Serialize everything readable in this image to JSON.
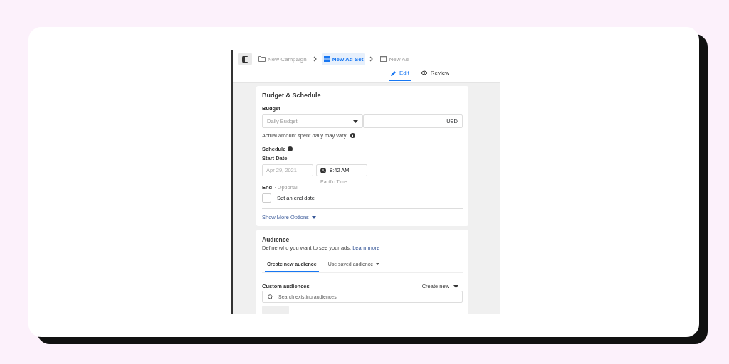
{
  "breadcrumbs": [
    {
      "label": "New Campaign",
      "kind": "folder",
      "selected": false
    },
    {
      "label": "New Ad Set",
      "kind": "grid",
      "selected": true
    },
    {
      "label": "New Ad",
      "kind": "window",
      "selected": false
    }
  ],
  "mode_tabs": [
    {
      "label": "Edit",
      "kind": "pencil",
      "selected": true
    },
    {
      "label": "Review",
      "kind": "eye",
      "selected": false
    }
  ],
  "budget_schedule": {
    "title": "Budget & Schedule",
    "budget_label": "Budget",
    "budget_type": {
      "placeholder": "Daily Budget"
    },
    "amount": {
      "currency": "USD"
    },
    "budget_note": "Actual amount spent daily may vary.",
    "schedule_label": "Schedule",
    "start_date_label": "Start Date",
    "start_date": {
      "placeholder": "Apr 29, 2021"
    },
    "start_time": "8:42 AM",
    "time_zone": "Pacific Time",
    "end_label": "End",
    "end_optional": "· Optional",
    "end_date_checkbox": {
      "label": "Set an end date",
      "checked": false
    },
    "more_options": "Show More Options"
  },
  "audience": {
    "title": "Audience",
    "description": "Define who you want to see your ads.",
    "learn_more": "Learn more",
    "tabs": [
      {
        "label": "Create new audience",
        "dropdown": false,
        "selected": true
      },
      {
        "label": "Use saved audience",
        "dropdown": true,
        "selected": false
      }
    ],
    "custom_audiences_label": "Custom audiences",
    "create_new": "Create new",
    "search": {
      "placeholder": "Search existing audiences"
    }
  }
}
